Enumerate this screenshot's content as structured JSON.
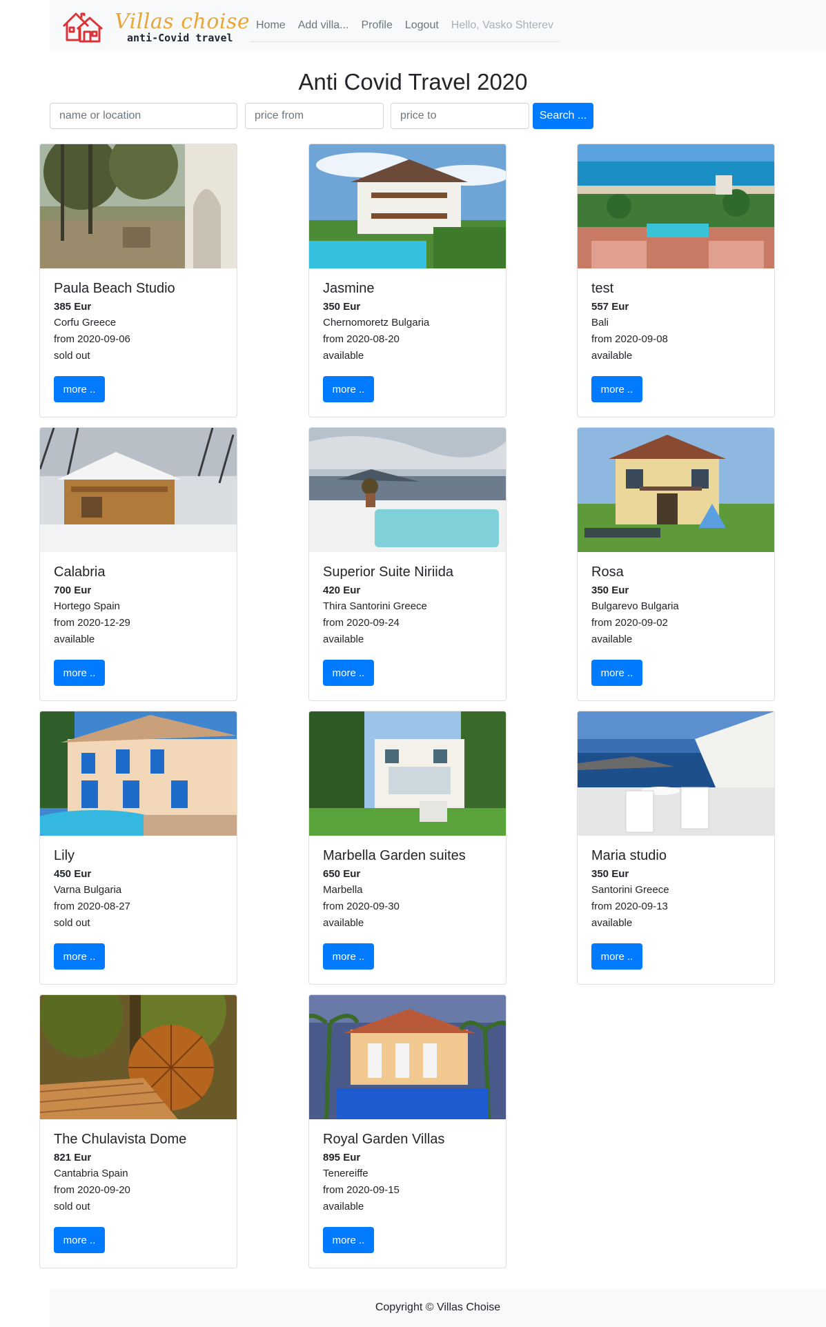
{
  "brand": {
    "title": "Villas choise",
    "subtitle": "anti-Covid travel"
  },
  "nav": {
    "home": "Home",
    "add_villa": "Add villa...",
    "profile": "Profile",
    "logout": "Logout",
    "greeting": "Hello, Vasko Shterev"
  },
  "page": {
    "title": "Anti Covid Travel 2020"
  },
  "search": {
    "name_placeholder": "name or location",
    "price_from_placeholder": "price from",
    "price_to_placeholder": "price to",
    "button_label": "Search ..."
  },
  "cards": [
    {
      "title": "Paula Beach Studio",
      "price": "385 Eur",
      "location": "Corfu Greece",
      "from": "from 2020-09-06",
      "status": "sold out",
      "button": "more ..",
      "image": "olive-grove-patio"
    },
    {
      "title": "Jasmine",
      "price": "350 Eur",
      "location": "Chernomoretz Bulgaria",
      "from": "from 2020-08-20",
      "status": "available",
      "button": "more ..",
      "image": "villa-with-pool"
    },
    {
      "title": "test",
      "price": "557 Eur",
      "location": "Bali",
      "from": "from 2020-09-08",
      "status": "available",
      "button": "more ..",
      "image": "seaside-resort"
    },
    {
      "title": "Calabria",
      "price": "700 Eur",
      "location": "Hortego Spain",
      "from": "from 2020-12-29",
      "status": "available",
      "button": "more ..",
      "image": "snowy-cabin"
    },
    {
      "title": "Superior Suite Niriida",
      "price": "420 Eur",
      "location": "Thira Santorini Greece",
      "from": "from 2020-09-24",
      "status": "available",
      "button": "more ..",
      "image": "santorini-jacuzzi"
    },
    {
      "title": "Rosa",
      "price": "350 Eur",
      "location": "Bulgarevo Bulgaria",
      "from": "from 2020-09-02",
      "status": "available",
      "button": "more ..",
      "image": "house-with-lawn"
    },
    {
      "title": "Lily",
      "price": "450 Eur",
      "location": "Varna Bulgaria",
      "from": "from 2020-08-27",
      "status": "sold out",
      "button": "more ..",
      "image": "blue-shutter-villa"
    },
    {
      "title": "Marbella Garden suites",
      "price": "650 Eur",
      "location": "Marbella",
      "from": "from 2020-09-30",
      "status": "available",
      "button": "more ..",
      "image": "garden-suite"
    },
    {
      "title": "Maria studio",
      "price": "350 Eur",
      "location": "Santorini Greece",
      "from": "from 2020-09-13",
      "status": "available",
      "button": "more ..",
      "image": "santorini-terrace"
    },
    {
      "title": "The Chulavista Dome",
      "price": "821 Eur",
      "location": "Cantabria Spain",
      "from": "from 2020-09-20",
      "status": "sold out",
      "button": "more ..",
      "image": "tree-dome"
    },
    {
      "title": "Royal Garden Villas",
      "price": "895 Eur",
      "location": "Tenereiffe",
      "from": "from 2020-09-15",
      "status": "available",
      "button": "more ..",
      "image": "palm-villa-pool"
    }
  ],
  "footer": {
    "text": "Copyright © Villas Choise"
  },
  "colors": {
    "primary": "#007bff",
    "navbar_bg": "#f8f9fa",
    "brand_gold": "#e8a63a",
    "brand_red": "#d9343a"
  }
}
